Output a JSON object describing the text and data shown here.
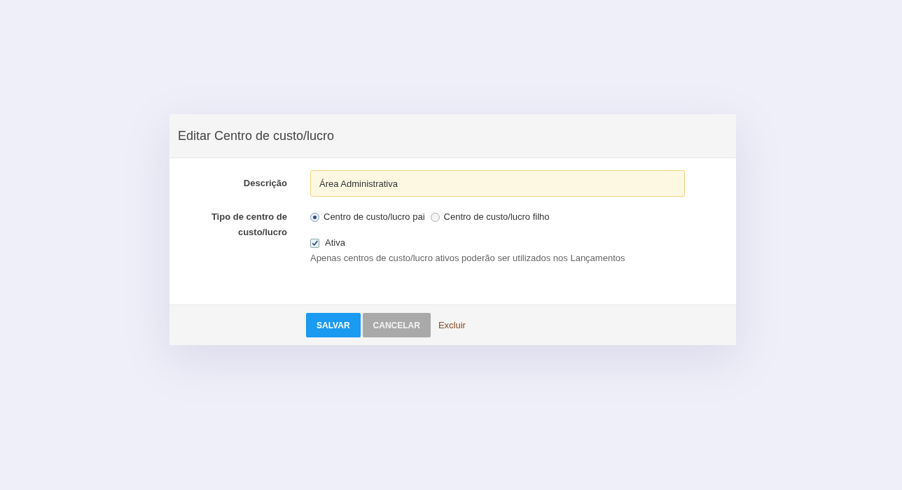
{
  "dialog": {
    "title": "Editar Centro de custo/lucro",
    "description": {
      "label": "Descrição",
      "value": "Área Administrativa"
    },
    "type": {
      "label": "Tipo de centro de custo/lucro",
      "options": [
        {
          "label": "Centro de custo/lucro pai",
          "selected": true
        },
        {
          "label": "Centro de custo/lucro filho",
          "selected": false
        }
      ]
    },
    "active": {
      "label": "Ativa",
      "checked": true,
      "help": "Apenas centros de custo/lucro ativos poderão ser utilizados nos Lançamentos"
    },
    "buttons": [
      {
        "label": "SALVAR",
        "kind": "primary"
      },
      {
        "label": "CANCELAR",
        "kind": "secondary"
      },
      {
        "label": "Excluir",
        "kind": "link"
      }
    ]
  }
}
